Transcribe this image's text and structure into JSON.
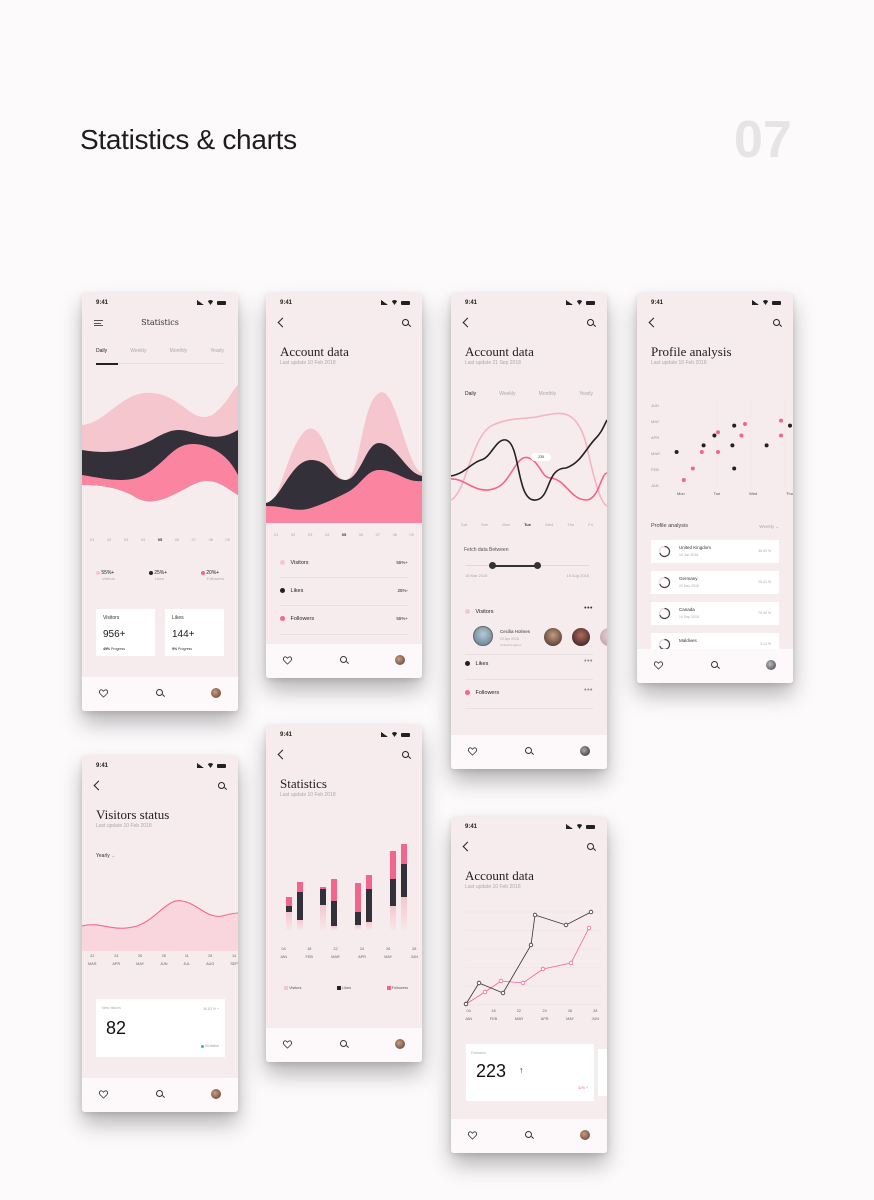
{
  "page": {
    "title": "Statistics & charts",
    "number": "07"
  },
  "colors": {
    "light_pink": "#f6c6cf",
    "pink": "#fb85a1",
    "hot_pink": "#f2668d",
    "dark": "#33303a",
    "green": "#25c58b",
    "bg": "#f6eced"
  },
  "status": {
    "time": "9:41"
  },
  "icons": {
    "back": "chevron-left-icon",
    "search": "search-icon",
    "menu": "menu-icon",
    "heart": "heart-icon",
    "avatar": "avatar",
    "more": "more-horizontal-icon"
  },
  "screen1": {
    "nav_title": "Statistics",
    "tabs": [
      "Daily",
      "Weekly",
      "Monthly",
      "Yearly"
    ],
    "active_tab": "Daily",
    "axis": [
      "01",
      "02",
      "03",
      "04",
      "05",
      "06",
      "07",
      "08",
      "09"
    ],
    "legend": [
      {
        "value": "55%+",
        "label": "Visitors"
      },
      {
        "value": "25%+",
        "label": "Likes"
      },
      {
        "value": "20%+",
        "label": "Followers"
      }
    ],
    "cards": [
      {
        "title": "Visitors",
        "value": "956+",
        "progress_pct": "49%",
        "progress_label": "Progress"
      },
      {
        "title": "Likes",
        "value": "144+",
        "progress_pct": "9%",
        "progress_label": "Progress"
      }
    ]
  },
  "screen2": {
    "title": "Account data",
    "subtitle": "Last update 10 Feb 2018",
    "axis": [
      "01",
      "02",
      "03",
      "04",
      "05",
      "06",
      "07",
      "08",
      "09"
    ],
    "rows": [
      {
        "label": "Visitors",
        "value": "55%+"
      },
      {
        "label": "Likes",
        "value": "25%-"
      },
      {
        "label": "Followers",
        "value": "55%+"
      }
    ]
  },
  "screen3": {
    "title": "Account data",
    "subtitle": "Last update 21 Sep 2018",
    "tabs": [
      "Daily",
      "Weekly",
      "Monthly",
      "Yearly"
    ],
    "active_tab": "Daily",
    "tooltip": "235",
    "axis": [
      "Sat",
      "Sun",
      "Mon",
      "Tue",
      "Wed",
      "Thu",
      "Fri"
    ],
    "range": {
      "label": "Fetch data Between",
      "start": "18 Mar 2018",
      "end": "15 Aug 2018"
    },
    "visitors": {
      "label": "Visitors",
      "person": {
        "name": "Cecilia Holmes",
        "date": "22 Apr 2018",
        "country": "United Kingdom"
      }
    },
    "rows": [
      {
        "label": "Likes"
      },
      {
        "label": "Followers"
      }
    ]
  },
  "screen4": {
    "title": "Profile analysis",
    "subtitle": "Last update 10 Feb 2018",
    "y_axis": [
      "JUN",
      "MAY",
      "APR",
      "MAR",
      "FEB",
      "JAN"
    ],
    "x_axis": [
      "Mon",
      "Tue",
      "Wed",
      "Thu"
    ],
    "section": "Profile analysis",
    "filter": "Weekly",
    "items": [
      {
        "country": "United Kingdom",
        "date": "15 Jun 2018",
        "value": "36,63 %"
      },
      {
        "country": "Germany",
        "date": "22 Dec 2018",
        "value": "25,41 %"
      },
      {
        "country": "Canada",
        "date": "19 Sep 2018",
        "value": "79,40 %"
      },
      {
        "country": "Maldives",
        "date": "",
        "value": "3,12 %"
      }
    ]
  },
  "screen5": {
    "title": "Visitors status",
    "subtitle": "Last update 10 Feb 2018",
    "filter": "Yearly",
    "axis": [
      {
        "day": "22",
        "month": "MAR"
      },
      {
        "day": "24",
        "month": "APR"
      },
      {
        "day": "26",
        "month": "MAY"
      },
      {
        "day": "28",
        "month": "JUN"
      },
      {
        "day": "11",
        "month": "JUL"
      },
      {
        "day": "28",
        "month": "AUG"
      },
      {
        "day": "14",
        "month": "SEP"
      }
    ],
    "card": {
      "title": "New visitors",
      "value": "82",
      "change": "36,63 % +",
      "active": "43 Active"
    }
  },
  "screen6": {
    "title": "Statistics",
    "subtitle": "Last update 10 Feb 2018",
    "axis": [
      {
        "day": "04",
        "month": "JAN"
      },
      {
        "day": "18",
        "month": "FEB"
      },
      {
        "day": "22",
        "month": "MAR"
      },
      {
        "day": "24",
        "month": "APR"
      },
      {
        "day": "26",
        "month": "MAY"
      },
      {
        "day": "28",
        "month": "JUN"
      }
    ],
    "legend": [
      "Visitors",
      "Likes",
      "Followers"
    ]
  },
  "screen7": {
    "title": "Account data",
    "subtitle": "Last update 10 Feb 2018",
    "axis": [
      {
        "day": "04",
        "month": "JAN"
      },
      {
        "day": "18",
        "month": "FEB"
      },
      {
        "day": "22",
        "month": "MAR"
      },
      {
        "day": "24",
        "month": "APR"
      },
      {
        "day": "26",
        "month": "MAY"
      },
      {
        "day": "28",
        "month": "JUN"
      }
    ],
    "card": {
      "title": "Followers",
      "value": "223",
      "change": "32% +"
    }
  }
}
